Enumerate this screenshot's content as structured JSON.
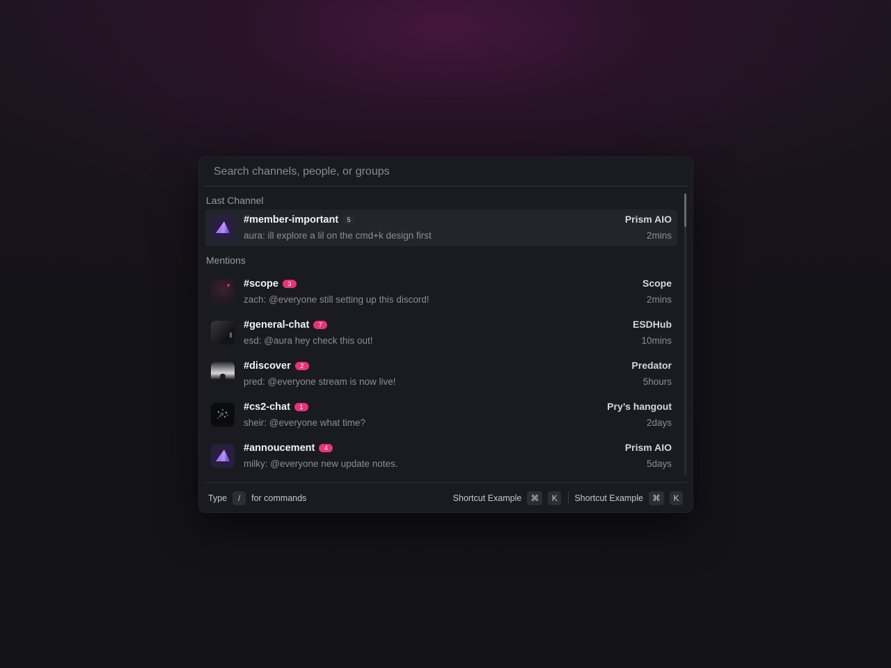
{
  "search": {
    "placeholder": "Search channels, people, or groups"
  },
  "sections": {
    "last_channel": "Last Channel",
    "mentions": "Mentions"
  },
  "last_channel": {
    "title": "#member-important",
    "badge": "5",
    "preview": "aura: ill explore a lil on the cmd+k design first",
    "server": "Prism AIO",
    "time": "2mins",
    "avatar": "prism-logo"
  },
  "mentions": [
    {
      "title": "#scope",
      "badge": "3",
      "preview": "zach: @everyone still setting up this discord!",
      "server": "Scope",
      "time": "2mins",
      "avatar": "scope-logo"
    },
    {
      "title": "#general-chat",
      "badge": "7",
      "preview": "esd: @aura hey check this out!",
      "server": "ESDHub",
      "time": "10mins",
      "avatar": "esdhub-logo"
    },
    {
      "title": "#discover",
      "badge": "2",
      "preview": "pred: @everyone stream is now live!",
      "server": "Predator",
      "time": "5hours",
      "avatar": "predator-logo"
    },
    {
      "title": "#cs2-chat",
      "badge": "1",
      "preview": "sheir: @everyone what time?",
      "server": "Pry’s hangout",
      "time": "2days",
      "avatar": "pry-logo"
    },
    {
      "title": "#annoucement",
      "badge": "4",
      "preview": "milky: @everyone new update notes.",
      "server": "Prism AIO",
      "time": "5days",
      "avatar": "prism-logo"
    }
  ],
  "footer": {
    "type_label": "Type",
    "slash_key": "/",
    "commands_label": "for commands",
    "shortcuts": [
      {
        "label": "Shortcut Example",
        "mod_key": "⌘",
        "key": "K"
      },
      {
        "label": "Shortcut Example",
        "mod_key": "⌘",
        "key": "K"
      }
    ]
  },
  "colors": {
    "accent_badge": "#e8337a",
    "panel": "#1a1b20",
    "selected_row": "#23252c"
  }
}
